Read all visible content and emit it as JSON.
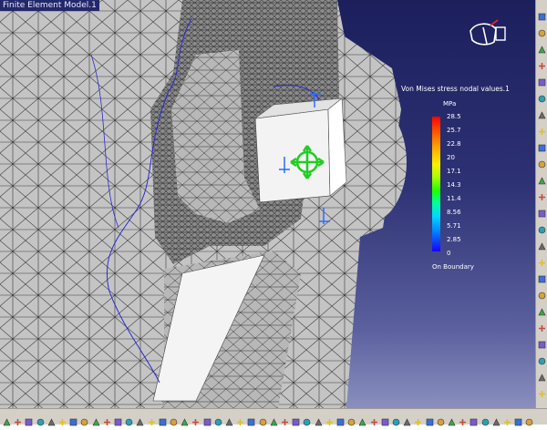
{
  "window": {
    "title": "Finite Element Model.1"
  },
  "legend": {
    "title": "Von Mises stress nodal values.1",
    "unit": "MPa",
    "ticks": [
      "28.5",
      "25.7",
      "22.8",
      "20",
      "17.1",
      "14.3",
      "11.4",
      "8.56",
      "5.71",
      "2.85",
      "0"
    ],
    "footer": "On Boundary"
  },
  "colors": {
    "background_top": "#1c1f5c",
    "background_bottom": "#8a8fbf",
    "mesh_fill": "#c8c8c8",
    "mesh_line": "#333333",
    "boundary_line": "#2b2bd0",
    "handle": "#22cc22",
    "restraint": "#2a6cff"
  },
  "compass": {
    "icon": "compass-axis-icon"
  },
  "right_toolbar": {
    "icons": [
      "view-icon",
      "rotate-icon",
      "zoom-icon",
      "pan-icon",
      "fit-icon",
      "normal-view-icon",
      "shading-icon",
      "hide-icon",
      "swap-icon",
      "iso-view-icon",
      "front-view-icon",
      "back-view-icon",
      "left-view-icon",
      "right-view-icon",
      "top-view-icon",
      "bottom-view-icon",
      "named-view-icon",
      "render-icon",
      "mesh-icon",
      "analysis-icon",
      "results-icon",
      "report-icon",
      "measure-icon",
      "settings-icon"
    ]
  },
  "bottom_toolbar": {
    "icons": [
      "new-icon",
      "open-icon",
      "save-icon",
      "print-icon",
      "cut-icon",
      "copy-icon",
      "paste-icon",
      "undo-icon",
      "redo-icon",
      "help-icon",
      "select-icon",
      "catalog-icon",
      "knowledge-icon",
      "fly-icon",
      "fit-all-icon",
      "pan-icon",
      "rotate-icon",
      "zoom-in-icon",
      "zoom-out-icon",
      "normal-view-icon",
      "multi-view-icon",
      "iso-view-icon",
      "shading-icon",
      "hide-show-icon",
      "swap-space-icon",
      "measure-icon",
      "apply-material-icon",
      "mesh-icon",
      "restraint-icon",
      "load-icon",
      "compute-icon",
      "image-icon",
      "deformation-icon",
      "stress-icon",
      "animate-icon",
      "cut-plane-icon",
      "report-icon",
      "history-icon",
      "sensor-icon",
      "info-icon",
      "search-icon",
      "grid-icon",
      "snap-icon",
      "filter-icon",
      "trace-icon",
      "light-icon",
      "camera-icon",
      "settings-icon"
    ]
  }
}
